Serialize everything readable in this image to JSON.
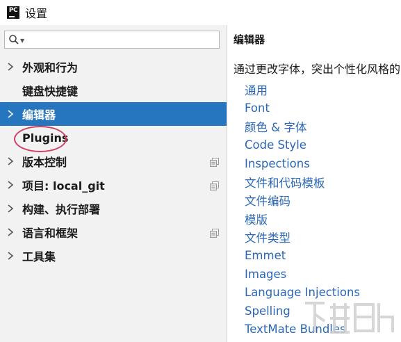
{
  "window": {
    "title": "设置",
    "app_icon_text": "PC"
  },
  "search": {
    "value": "",
    "placeholder": ""
  },
  "tree": {
    "items": [
      {
        "label": "外观和行为",
        "expandable": true,
        "selected": false,
        "copy_icon": false
      },
      {
        "label": "键盘快捷键",
        "expandable": false,
        "selected": false,
        "copy_icon": false
      },
      {
        "label": "编辑器",
        "expandable": true,
        "selected": true,
        "copy_icon": false
      },
      {
        "label": "Plugins",
        "expandable": false,
        "selected": false,
        "copy_icon": false
      },
      {
        "label": "版本控制",
        "expandable": true,
        "selected": false,
        "copy_icon": true
      },
      {
        "label": "项目: local_git",
        "expandable": true,
        "selected": false,
        "copy_icon": true
      },
      {
        "label": "构建、执行部署",
        "expandable": true,
        "selected": false,
        "copy_icon": false
      },
      {
        "label": "语言和框架",
        "expandable": true,
        "selected": false,
        "copy_icon": true
      },
      {
        "label": "工具集",
        "expandable": true,
        "selected": false,
        "copy_icon": false
      }
    ]
  },
  "content": {
    "title": "编辑器",
    "description": "通过更改字体，突出个性化风格的",
    "links": [
      "通用",
      "Font",
      "颜色 & 字体",
      "Code Style",
      "Inspections",
      "文件和代码模板",
      "文件编码",
      "模版",
      "文件类型",
      "Emmet",
      "Images",
      "Language Injections",
      "Spelling",
      "TextMate Bundles"
    ]
  },
  "colors": {
    "selection": "#2675bf",
    "link": "#2a67b8",
    "highlight_ring": "#d23c64"
  },
  "icons": {
    "search": "search-icon",
    "expand": "chevron-right-icon",
    "project_scope": "copy-icon"
  }
}
